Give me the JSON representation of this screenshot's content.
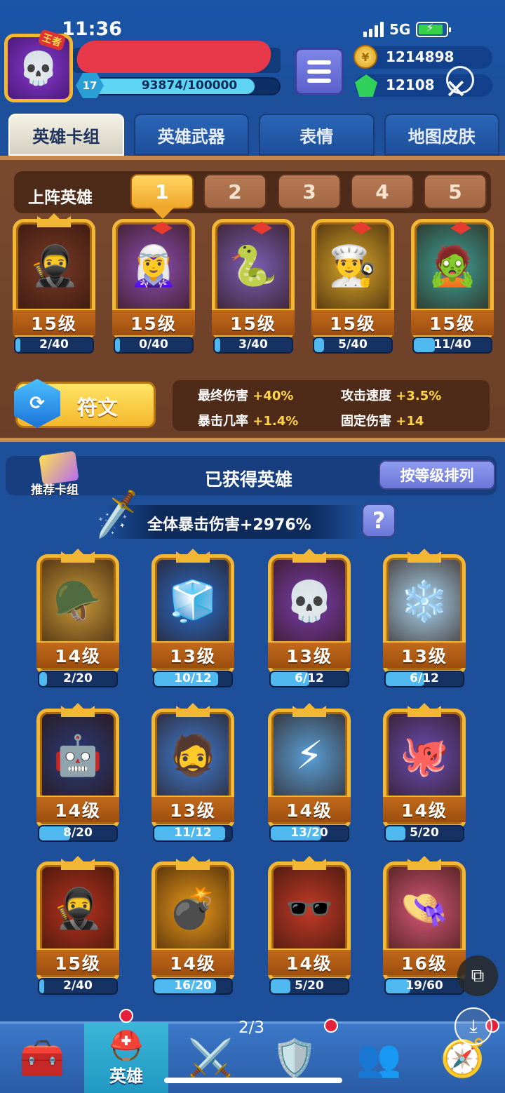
{
  "status_bar": {
    "time": "11:36",
    "network": "5G"
  },
  "player": {
    "title_badge": "王者",
    "xp": "93874/100000",
    "xp_fraction": 0.939,
    "level": "17"
  },
  "currency": {
    "coins": "1214898",
    "gems": "12108"
  },
  "tabs": [
    "英雄卡组",
    "英雄武器",
    "表情",
    "地图皮肤"
  ],
  "lineup": {
    "title": "上阵英雄",
    "decks": [
      "1",
      "2",
      "3",
      "4",
      "5"
    ],
    "heroes": [
      {
        "icon": "ninja-hero-icon",
        "emoji": "🥷",
        "bg": "#7a3a28",
        "level": "15级",
        "progress": "2/40",
        "fraction": 0.05
      },
      {
        "icon": "sorceress-hero-icon",
        "emoji": "🧝‍♀️",
        "bg": "#8e4fb3",
        "level": "15级",
        "progress": "0/40",
        "fraction": 0.0
      },
      {
        "icon": "medusa-hero-icon",
        "emoji": "🐍",
        "bg": "#7b5fb8",
        "level": "15级",
        "progress": "3/40",
        "fraction": 0.075
      },
      {
        "icon": "chef-hero-icon",
        "emoji": "👨‍🍳",
        "bg": "#d8a72a",
        "level": "15级",
        "progress": "5/40",
        "fraction": 0.125
      },
      {
        "icon": "zombie-hero-icon",
        "emoji": "🧟",
        "bg": "#3fa59a",
        "level": "15级",
        "progress": "11/40",
        "fraction": 0.275
      }
    ]
  },
  "rune": {
    "label": "符文",
    "stats": [
      {
        "name": "最终伤害",
        "value": "+40%"
      },
      {
        "name": "攻击速度",
        "value": "+3.5%"
      },
      {
        "name": "暴击几率",
        "value": "+1.4%"
      },
      {
        "name": "固定伤害",
        "value": "+14"
      }
    ]
  },
  "collection": {
    "recommend_label": "推荐卡组",
    "title": "已获得英雄",
    "sort_label": "按等级排列",
    "crit_bonus": "全体暴击伤害+2976%",
    "help": "?",
    "heroes": [
      {
        "icon": "knight-hero-icon",
        "emoji": "🪖",
        "bg": "#c89a3a",
        "level": "14级",
        "progress": "2/20",
        "fraction": 0.1
      },
      {
        "icon": "ice-golem-hero-icon",
        "emoji": "🧊",
        "bg": "#2a6fd0",
        "level": "13级",
        "progress": "10/12",
        "fraction": 0.83
      },
      {
        "icon": "skull-mage-hero-icon",
        "emoji": "💀",
        "bg": "#7b3fb0",
        "level": "13级",
        "progress": "6/12",
        "fraction": 0.5
      },
      {
        "icon": "yeti-hero-icon",
        "emoji": "❄️",
        "bg": "#a8d4f0",
        "level": "13级",
        "progress": "6/12",
        "fraction": 0.5
      },
      {
        "icon": "cyber-hero-icon",
        "emoji": "🤖",
        "bg": "#2a3b7a",
        "level": "14级",
        "progress": "8/20",
        "fraction": 0.4
      },
      {
        "icon": "frost-king-hero-icon",
        "emoji": "🧔",
        "bg": "#3f7fd8",
        "level": "13级",
        "progress": "11/12",
        "fraction": 0.92
      },
      {
        "icon": "zeus-hero-icon",
        "emoji": "⚡",
        "bg": "#5aa0d8",
        "level": "14级",
        "progress": "13/20",
        "fraction": 0.65
      },
      {
        "icon": "octopus-pirate-hero-icon",
        "emoji": "🐙",
        "bg": "#6a4fb8",
        "level": "14级",
        "progress": "5/20",
        "fraction": 0.25
      },
      {
        "icon": "fire-ninja-hero-icon",
        "emoji": "🥷",
        "bg": "#b8321f",
        "level": "15级",
        "progress": "2/40",
        "fraction": 0.05
      },
      {
        "icon": "bomb-hero-icon",
        "emoji": "💣",
        "bg": "#e89a1a",
        "level": "14级",
        "progress": "16/20",
        "fraction": 0.8
      },
      {
        "icon": "agent-hero-icon",
        "emoji": "🕶️",
        "bg": "#c23a28",
        "level": "14级",
        "progress": "5/20",
        "fraction": 0.25
      },
      {
        "icon": "pink-lady-hero-icon",
        "emoji": "👒",
        "bg": "#d8587a",
        "level": "16级",
        "progress": "19/60",
        "fraction": 0.32
      }
    ]
  },
  "bottom_nav": [
    {
      "icon": "treasure-chest-icon",
      "emoji": "🧰",
      "label": "",
      "active": false
    },
    {
      "icon": "knight-helmet-icon",
      "emoji": "⛑️",
      "label": "英雄",
      "active": true
    },
    {
      "icon": "crossed-swords-icon",
      "emoji": "⚔️",
      "label": "",
      "active": false
    },
    {
      "icon": "shield-crown-icon",
      "emoji": "🛡️",
      "label": "",
      "active": false
    },
    {
      "icon": "team-icon",
      "emoji": "👥",
      "label": "",
      "active": false
    },
    {
      "icon": "compass-icon",
      "emoji": "🧭",
      "label": "",
      "active": false
    }
  ],
  "page_indicator": "2/3"
}
